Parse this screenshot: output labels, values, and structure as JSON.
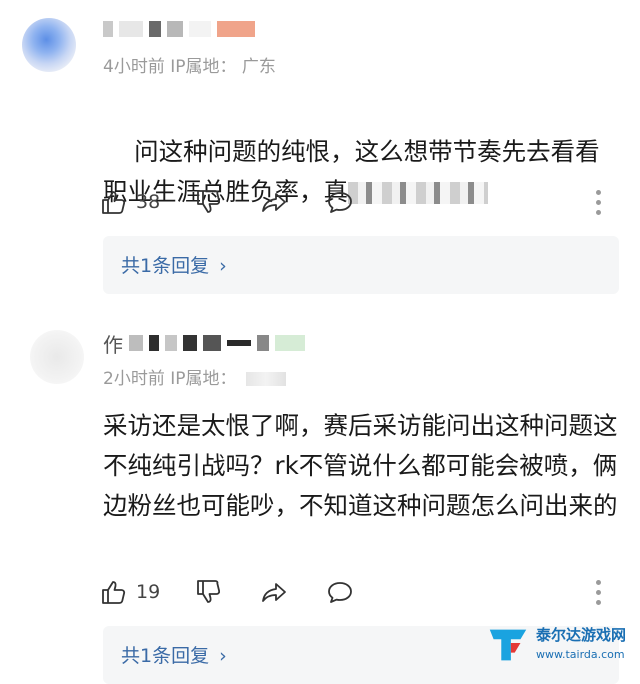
{
  "comments": [
    {
      "meta_time": "4小时前",
      "meta_ip_label": "IP属地：",
      "meta_location": "广东",
      "text_main": "问这种问题的纯恨，这么想带节奏先去看看职业生涯总胜负率，真",
      "likes": "38",
      "reply_label": "共1条回复",
      "reply_chevron": "›"
    },
    {
      "name_prefix": "作",
      "meta_time": "2小时前",
      "meta_ip_label": "IP属地：",
      "meta_location": "",
      "text_main": "采访还是太恨了啊，赛后采访能问出这种问题这不纯纯引战吗？rk不管说什么都可能会被喷，俩边粉丝也可能吵，不知道这种问题怎么问出来的",
      "likes": "19",
      "reply_label": "共1条回复",
      "reply_chevron": "›"
    }
  ],
  "icons": {
    "like": "thumbs-up-icon",
    "dislike": "thumbs-down-icon",
    "share": "share-icon",
    "reply": "comment-bubble-icon",
    "more": "more-vertical-icon"
  },
  "watermark": {
    "name": "泰尔达游戏网",
    "url": "www.tairda.com"
  },
  "colors": {
    "link": "#3a6aa6",
    "meta": "#9a9a9a",
    "reply_bg": "#f5f6f7"
  }
}
